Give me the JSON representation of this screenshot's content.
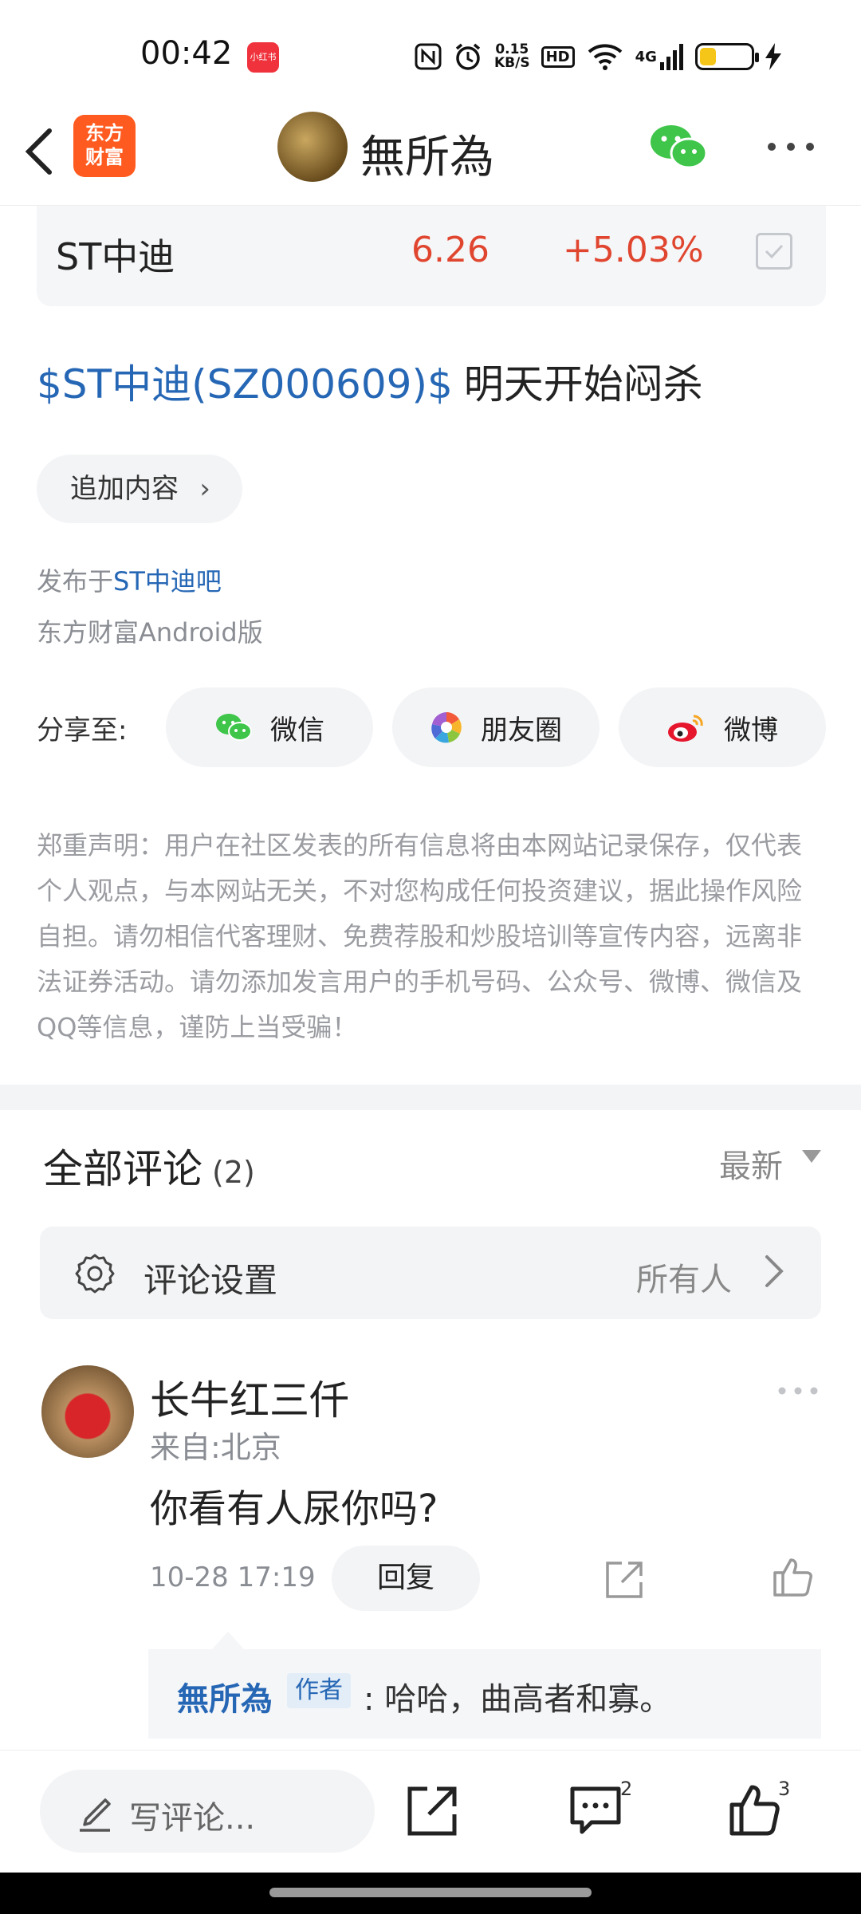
{
  "status_bar": {
    "time": "00:42",
    "app_badge": "小红书",
    "net_speed_value": "0.15",
    "net_speed_unit": "KB/S",
    "hd": "HD",
    "signal": "4G",
    "battery_level": 0.3
  },
  "nav": {
    "logo_line1": "东方",
    "logo_line2": "财富",
    "title": "無所為"
  },
  "stock": {
    "name": "ST中迪",
    "price": "6.26",
    "change": "+5.03%"
  },
  "post": {
    "title_link": "$ST中迪(SZ000609)$",
    "title_text": "明天开始闷杀",
    "append_label": "追加内容",
    "published_prefix": "发布于",
    "published_bar": "ST中迪吧",
    "client": "东方财富Android版"
  },
  "share": {
    "label": "分享至:",
    "wechat": "微信",
    "moments": "朋友圈",
    "weibo": "微博"
  },
  "disclaimer": "郑重声明：用户在社区发表的所有信息将由本网站记录保存，仅代表个人观点，与本网站无关，不对您构成任何投资建议，据此操作风险自担。请勿相信代客理财、免费荐股和炒股培训等宣传内容，远离非法证券活动。请勿添加发言用户的手机号码、公众号、微博、微信及QQ等信息，谨防上当受骗！",
  "comments": {
    "title": "全部评论",
    "count": "(2)",
    "sort": "最新",
    "settings_label": "评论设置",
    "settings_value": "所有人",
    "items": [
      {
        "name": "长牛红三仟",
        "location": "来自:北京",
        "text": "你看有人尿你吗?",
        "time": "10-28 17:19",
        "reply_label": "回复",
        "reply": {
          "author": "無所為",
          "tag": "作者",
          "text": ": 哈哈，曲高者和寡。"
        }
      }
    ]
  },
  "bottom_bar": {
    "write_placeholder": "写评论...",
    "comment_count": "2",
    "like_count": "3"
  }
}
